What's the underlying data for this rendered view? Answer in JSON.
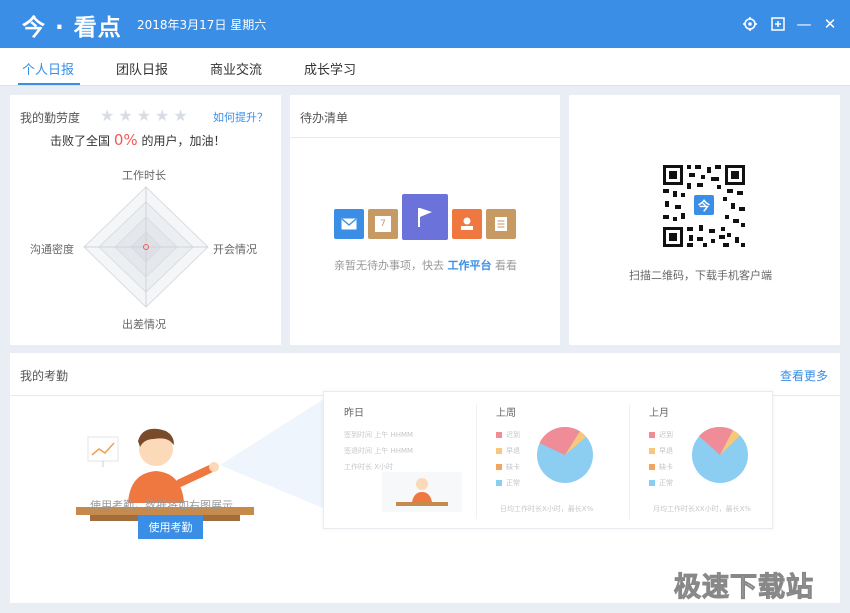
{
  "app": {
    "title": "今 · 看点",
    "date": "2018年3月17日 星期六"
  },
  "window_controls": {
    "settings_icon": "gear-icon",
    "maximize_icon": "plus-box-icon",
    "minimize_icon": "minus-icon",
    "close_icon": "close-icon",
    "minimize_label": "—",
    "close_label": "✕"
  },
  "tabs": [
    {
      "label": "个人日报",
      "active": true
    },
    {
      "label": "团队日报",
      "active": false
    },
    {
      "label": "商业交流",
      "active": false
    },
    {
      "label": "成长学习",
      "active": false
    }
  ],
  "diligence": {
    "title": "我的勤劳度",
    "stars": "★★★★★",
    "rating": 0,
    "improve_link": "如何提升？",
    "beat_prefix": "击败了全国",
    "beat_percent": "0%",
    "beat_suffix": "的用户，加油！",
    "radar_labels": {
      "top": "工作时长",
      "right": "开会情况",
      "bottom": "出差情况",
      "left": "沟通密度"
    }
  },
  "todo": {
    "title": "待办清单",
    "empty_prefix": "亲暂无待办事项，快去",
    "platform_link": "工作平台",
    "empty_suffix": "看看",
    "icons": [
      "mail-icon",
      "calendar-icon",
      "flag-icon",
      "stamp-icon",
      "document-icon"
    ],
    "calendar_day": "7",
    "colors": [
      "#3a8ee6",
      "#c79a63",
      "#6b72d9",
      "#ef7840",
      "#c79a63"
    ]
  },
  "qrcode": {
    "center_text": "今",
    "text": "扫描二维码，下载手机客户端"
  },
  "attendance": {
    "title": "我的考勤",
    "more_link": "查看更多",
    "desc": "使用考勤，数据将如右图展示",
    "button": "使用考勤",
    "preview": {
      "yesterday": {
        "title": "昨日",
        "rows": [
          "签到时间  上午 HHMM",
          "签退时间  上午 HHMM",
          "工作时长  X小时"
        ]
      },
      "last_week": {
        "title": "上周",
        "legend": [
          "迟到",
          "早退",
          "缺卡",
          "正常"
        ],
        "footer": "日均工作时长X小时，最长X%"
      },
      "last_month": {
        "title": "上月",
        "legend": [
          "迟到",
          "早退",
          "缺卡",
          "正常"
        ],
        "footer": "月均工作时长XX小时，最长X%"
      },
      "legend_colors": [
        "#f08c98",
        "#f7c77a",
        "#f4a45e",
        "#8ccdf2"
      ]
    }
  },
  "watermark": "极速下载站"
}
